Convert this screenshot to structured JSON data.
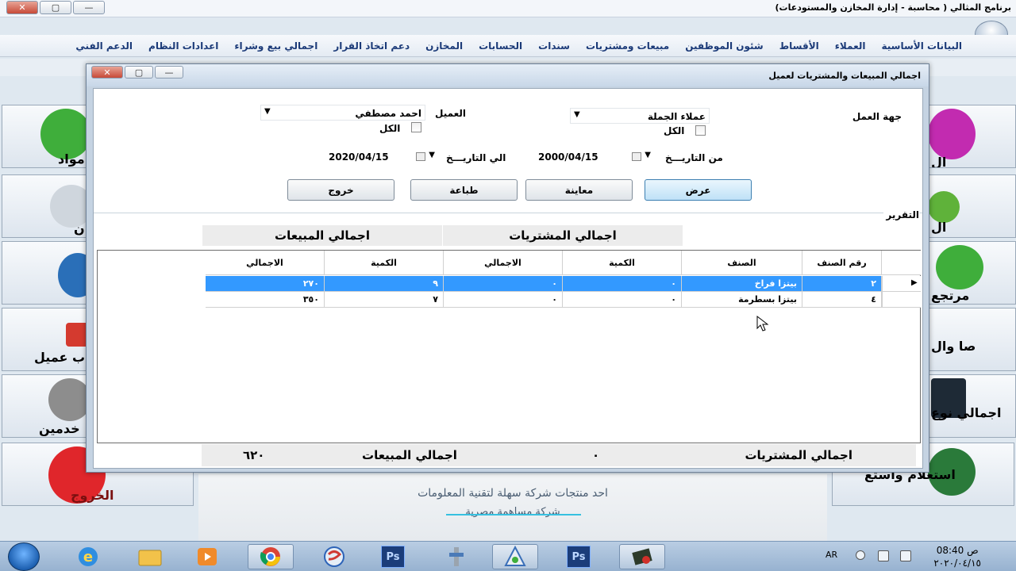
{
  "app": {
    "title": "برنامج المثالي ( محاسبة - إدارة المخازن والمستودعات)",
    "window_buttons": {
      "close": "✕",
      "restore": "▢",
      "minimize": "—"
    }
  },
  "menu": [
    "البيانات الأساسية",
    "العملاء",
    "الأقساط",
    "شئون الموظفين",
    "مبيعات ومشتريات",
    "سندات",
    "الحسابات",
    "المخازن",
    "دعم اتخاذ القرار",
    "اجمالي بيع وشراء",
    "اعدادات النظام",
    "الدعم الفني"
  ],
  "background": {
    "left_tiles": [
      "مواد",
      "ن",
      "",
      "ب عميل",
      "خدمين",
      "الخروج"
    ],
    "right_tiles": [
      "ال",
      "ال",
      "مرتجع",
      "صا وال",
      "اجمالي نوع",
      "استعلام واستع"
    ],
    "company_line1": "احد منتجات شركة سهلة لتقنية المعلومات",
    "company_line2": "شركة مساهمة مصرية"
  },
  "dialog": {
    "title": "اجمالي المبيعات والمشتريات لعميل",
    "buttons": {
      "close": "✕",
      "restore": "▢",
      "minimize": "—"
    },
    "fields": {
      "party_label": "جهة العمل",
      "party_value": "عملاء الجملة",
      "party_all_label": "الكل",
      "customer_label": "العميل",
      "customer_value": "احمد مصطفي",
      "customer_all_label": "الكل",
      "from_label": "من التاريـــخ",
      "from_value": "2000/04/15",
      "to_label": "الي التاريـــخ",
      "to_value": "2020/04/15"
    },
    "actions": {
      "view": "عرض",
      "preview": "معاينة",
      "print": "طباعة",
      "exit": "خروج"
    },
    "report_label": "التقرير",
    "section_purchases": "اجمالي المشتريات",
    "section_sales": "اجمالي المبيعات",
    "grid": {
      "headers": {
        "item_no": "رقم الصنف",
        "item": "الصنف",
        "p_qty": "الكمية",
        "p_total": "الاجمالي",
        "s_qty": "الكمية",
        "s_total": "الاجمالي"
      },
      "rows": [
        {
          "item_no": "٢",
          "item": "بيتزا فراخ",
          "p_qty": "٠",
          "p_total": "٠",
          "s_qty": "٩",
          "s_total": "٢٧٠",
          "selected": true
        },
        {
          "item_no": "٤",
          "item": "بيتزا بسطرمة",
          "p_qty": "٠",
          "p_total": "٠",
          "s_qty": "٧",
          "s_total": "٣٥٠",
          "selected": false
        }
      ]
    },
    "footer": {
      "purchases_label": "اجمالي المشتريات",
      "purchases_value": "٠",
      "sales_label": "اجمالي المبيعات",
      "sales_value": "٦٢٠"
    }
  },
  "taskbar": {
    "apps": [
      "ie-icon",
      "folder-icon",
      "media-icon",
      "chrome-icon",
      "app-icon",
      "photoshop-icon",
      "tool-icon",
      "app-icon",
      "photoshop-icon",
      "app-icon"
    ],
    "ps_label": "Ps",
    "lang": "AR",
    "time": "08:40",
    "ampm": "ص",
    "date": "٢٠٢٠/٠٤/١٥"
  }
}
